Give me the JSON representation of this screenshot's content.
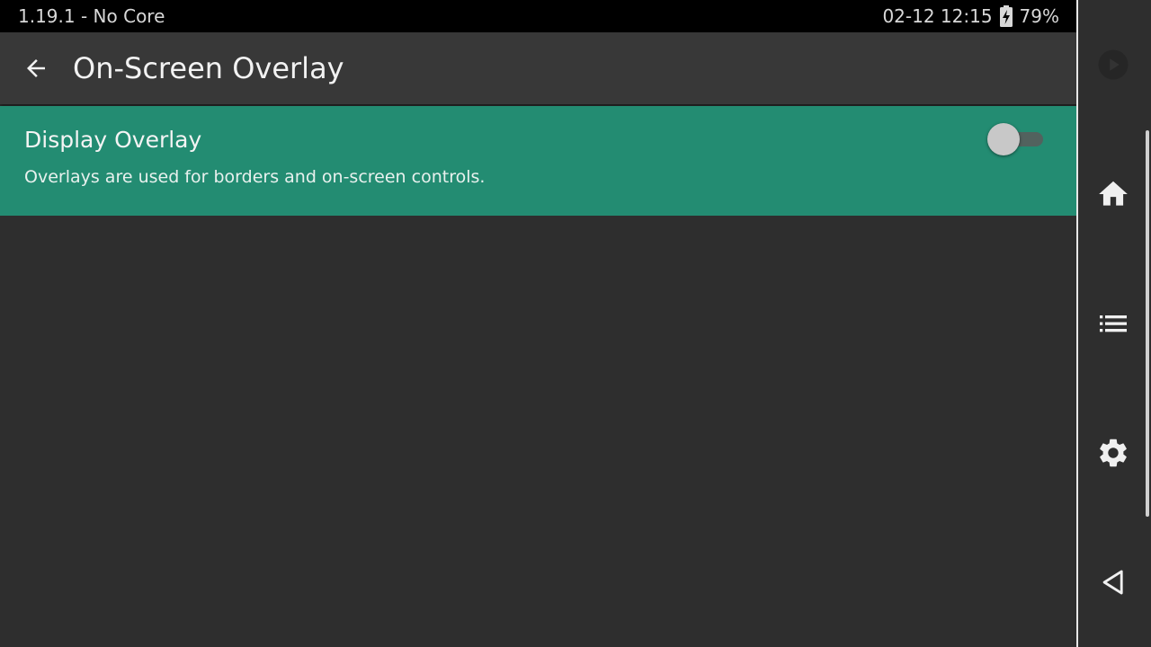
{
  "status_bar": {
    "left_text": "1.19.1 - No Core",
    "datetime": "02-12 12:15",
    "battery_percent": "79%",
    "battery_icon": "battery-charging-icon"
  },
  "toolbar": {
    "back_icon": "arrow-back-icon",
    "title": "On-Screen Overlay"
  },
  "setting": {
    "title": "Display Overlay",
    "summary": "Overlays are used for borders and on-screen controls.",
    "toggle_on": false
  },
  "nav_rail": {
    "items": [
      {
        "icon": "play-icon"
      },
      {
        "icon": "home-icon"
      },
      {
        "icon": "list-icon"
      },
      {
        "icon": "gear-icon"
      },
      {
        "icon": "back-triangle-icon"
      }
    ]
  },
  "colors": {
    "accent": "#238c72",
    "background": "#2e2e2e",
    "toolbar": "#383838"
  }
}
